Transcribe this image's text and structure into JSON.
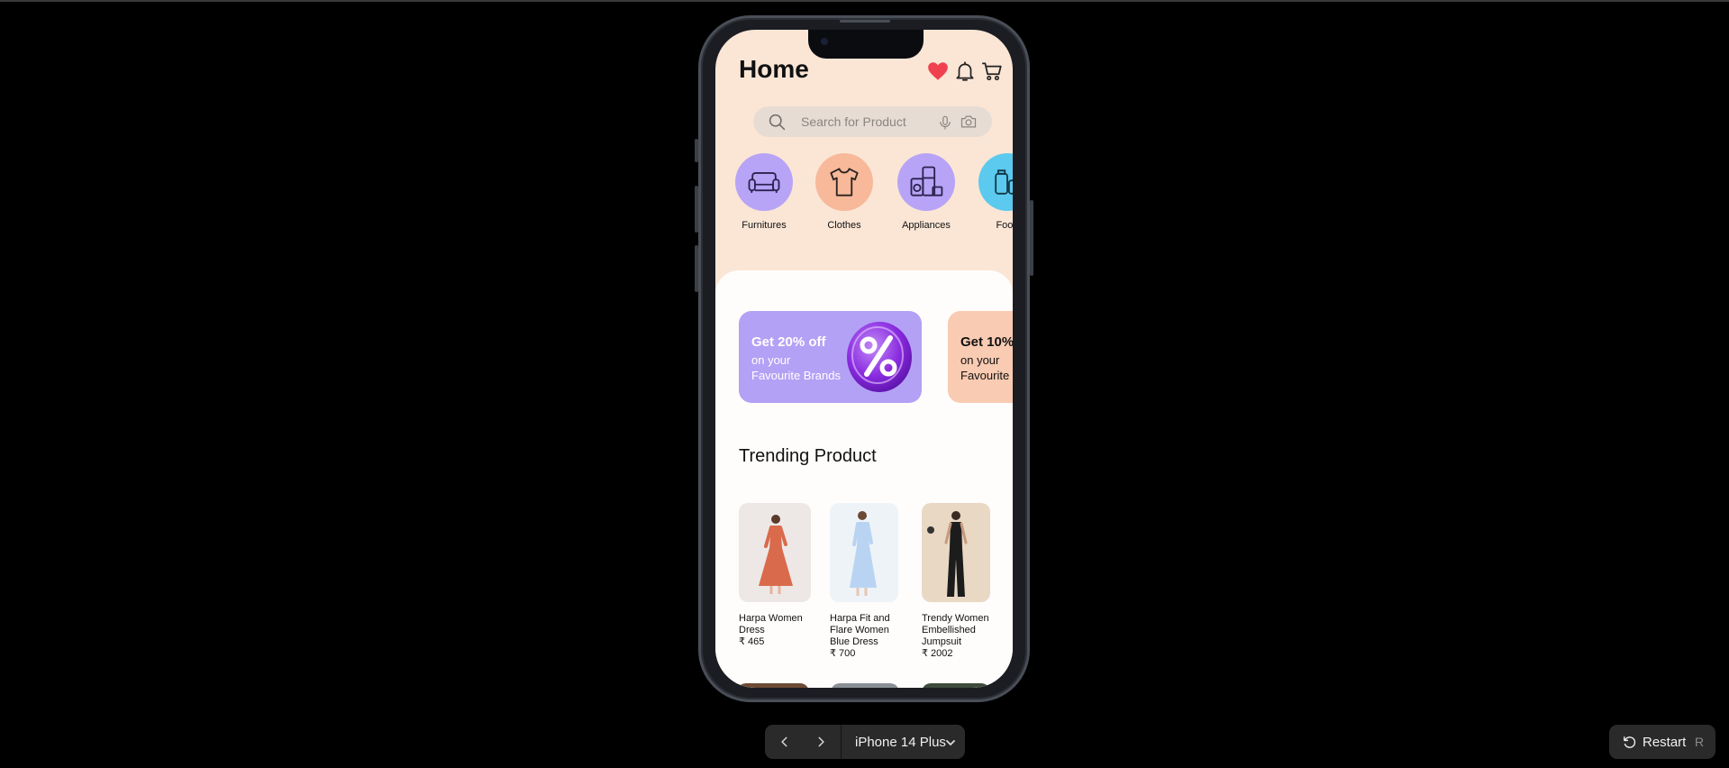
{
  "header": {
    "title": "Home",
    "icons": [
      "heart-icon",
      "bell-icon",
      "cart-icon"
    ],
    "heart_color": "#f0414f"
  },
  "search": {
    "placeholder": "Search for Product",
    "icons": [
      "search-icon",
      "microphone-icon",
      "camera-icon"
    ]
  },
  "categories": [
    {
      "label": "Furnitures",
      "icon": "sofa-icon",
      "color": "#b7a4f6"
    },
    {
      "label": "Clothes",
      "icon": "tshirt-icon",
      "color": "#f7b99a"
    },
    {
      "label": "Appliances",
      "icon": "appliances-icon",
      "color": "#b7a4f6"
    },
    {
      "label": "Food",
      "icon": "food-icon",
      "color": "#5cc9ee"
    }
  ],
  "promos": [
    {
      "line1": "Get 20% off",
      "line2": "on your",
      "line3": "Favourite Brands",
      "color": "#b3a1f5",
      "icon": "percent-icon"
    },
    {
      "line1": "Get 10%",
      "line2": "on your",
      "line3": "Favourite",
      "color": "#f9cbb2"
    }
  ],
  "trending": {
    "title": "Trending Product",
    "products": [
      {
        "name": "Harpa Women Dress",
        "price": "₹ 465"
      },
      {
        "name": "Harpa Fit and Flare Women Blue Dress",
        "price": "₹ 700"
      },
      {
        "name": "Trendy Women Embellished Jumpsuit",
        "price": "₹ 2002"
      }
    ]
  },
  "controls": {
    "prev_icon": "chevron-left-icon",
    "next_icon": "chevron-right-icon",
    "device": "iPhone 14 Plus",
    "restart_label": "Restart",
    "restart_key": "R"
  }
}
